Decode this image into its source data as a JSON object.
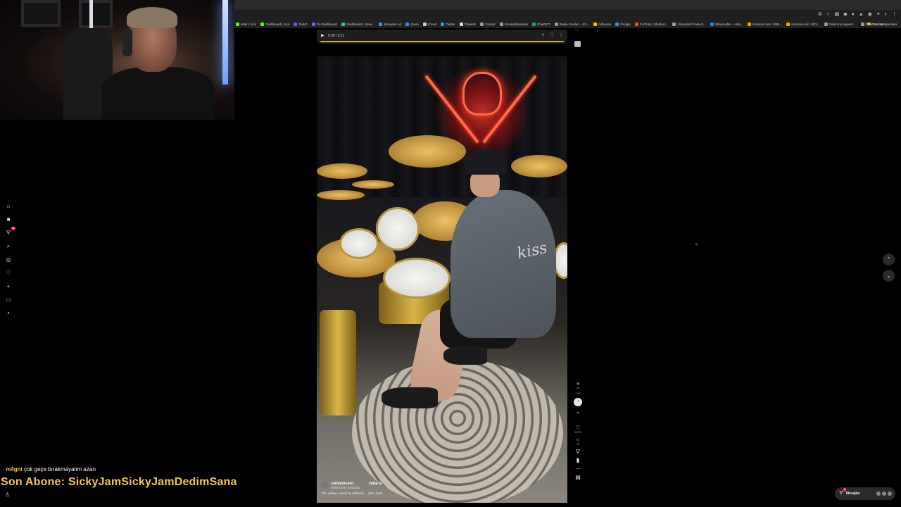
{
  "browser": {
    "bookmarks": [
      {
        "label": "ietler | Kick",
        "icon": "kick-icon",
        "color": "#53fc18"
      },
      {
        "label": "Dashboard | Kick",
        "icon": "kick-icon",
        "color": "#53fc18"
      },
      {
        "label": "Twitch",
        "icon": "twitch-icon",
        "color": "#9146ff"
      },
      {
        "label": "Tw Dashboard",
        "icon": "twitch-icon",
        "color": "#9146ff"
      },
      {
        "label": "Dashboard | Strea...",
        "icon": "streamelements-icon",
        "color": "#2ecc71"
      },
      {
        "label": "Streamer Ad",
        "icon": "link-icon",
        "color": "#4a90e2"
      },
      {
        "label": "Çeviri",
        "icon": "translate-icon",
        "color": "#4285f4"
      },
      {
        "label": "iCloud",
        "icon": "apple-icon",
        "color": "#cccccc"
      },
      {
        "label": "Twitter",
        "icon": "twitter-icon",
        "color": "#1da1f2"
      },
      {
        "label": "Threads",
        "icon": "threads-icon",
        "color": "#dddddd"
      },
      {
        "label": "Ozuruz",
        "icon": "globe-icon",
        "color": "#999999"
      },
      {
        "label": "StreamElements",
        "icon": "streamelements-icon",
        "color": "#999999"
      },
      {
        "label": "ChatGPT",
        "icon": "chatgpt-icon",
        "color": "#10a37f"
      },
      {
        "label": "Radio Garden – Kh...",
        "icon": "radio-icon",
        "color": "#999999"
      },
      {
        "label": "AdSense",
        "icon": "adsense-icon",
        "color": "#fbbc05"
      },
      {
        "label": "Google",
        "icon": "google-icon",
        "color": "#4285f4"
      },
      {
        "label": "Portfolio | Shutters...",
        "icon": "globe-icon",
        "color": "#e94b3c"
      },
      {
        "label": "Universal Producti...",
        "icon": "globe-icon",
        "color": "#999999"
      },
      {
        "label": "Streamable – vide...",
        "icon": "streamable-icon",
        "color": "#0f90fa"
      },
      {
        "label": "Amazon.com: USB...",
        "icon": "amazon-icon",
        "color": "#ff9900"
      },
      {
        "label": "Amazon.com: M2V...",
        "icon": "amazon-icon",
        "color": "#ff9900"
      },
      {
        "label": "Submit a request ...",
        "icon": "globe-icon",
        "color": "#999999"
      },
      {
        "label": "Drive & Listen",
        "icon": "globe-icon",
        "color": "#999999"
      }
    ],
    "all_bookmarks_label": "Tüm Yer İşaretleri"
  },
  "audio_player": {
    "time": "0:00 / 0:11",
    "progress": 0
  },
  "sidebar_nav": [
    {
      "name": "home-icon",
      "glyph": "⌂",
      "badge": ""
    },
    {
      "name": "explore-icon",
      "glyph": "■",
      "badge": ""
    },
    {
      "name": "following-icon",
      "glyph": "⛛",
      "badge": "99"
    },
    {
      "name": "search-icon",
      "glyph": "⌕",
      "badge": ""
    },
    {
      "name": "live-icon",
      "glyph": "◎",
      "badge": ""
    },
    {
      "name": "friends-icon",
      "glyph": "♡",
      "badge": ""
    },
    {
      "name": "upload-icon",
      "glyph": "+",
      "badge": ""
    },
    {
      "name": "messages-icon",
      "glyph": "▭",
      "badge": ""
    },
    {
      "name": "more-icon",
      "glyph": "•",
      "badge": ""
    }
  ],
  "video": {
    "username": "zakthedrumer",
    "follow_label": "Takip Et",
    "location": "Melbourne, Australia",
    "caption": "This calling. Mixed by @decibl ... daha fazla",
    "back_print": "kiss"
  },
  "actions": {
    "speed_label": "1x",
    "views": "7.4K",
    "likes": "2,273",
    "comments": "78",
    "shares": "",
    "saves": ""
  },
  "messages": {
    "label": "Mesajlar",
    "badge": "3"
  },
  "stream_overlay": {
    "chat_user": "m4gni",
    "chat_message": "çok geçe bırakmayalım azarı",
    "last_sub": "Son Abone: SickyJamSickyJamDedimSana"
  }
}
